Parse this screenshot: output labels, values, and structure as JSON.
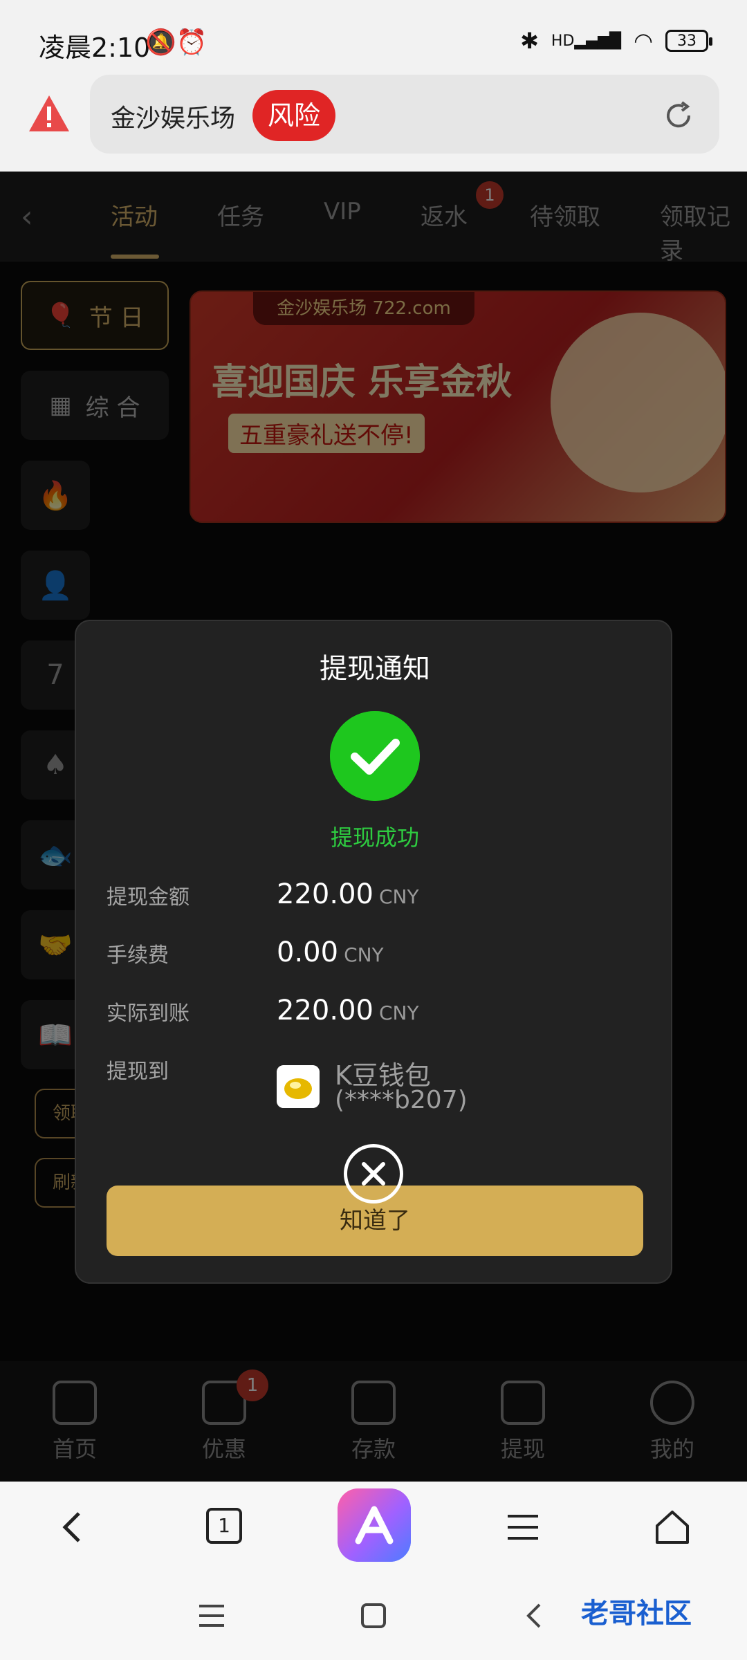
{
  "status_bar": {
    "time": "凌晨2:10",
    "battery": "33",
    "network": "HD"
  },
  "url_bar": {
    "site_name": "金沙娱乐场",
    "risk_label": "风险"
  },
  "tabs": {
    "items": [
      {
        "label": "活动",
        "active": true
      },
      {
        "label": "任务"
      },
      {
        "label": "VIP"
      },
      {
        "label": "返水",
        "badge": "1"
      },
      {
        "label": "待领取"
      },
      {
        "label": "领取记录"
      }
    ]
  },
  "sidebar": {
    "holiday": "节 日",
    "general": "综 合",
    "record_button": "领取记录",
    "refresh_button": "刷新奖励"
  },
  "banner": {
    "brand": "金沙娱乐场 722.com",
    "headline": "喜迎国庆 乐享金秋",
    "subline": "五重豪礼送不停!"
  },
  "modal": {
    "title": "提现通知",
    "status": "提现成功",
    "rows": [
      {
        "label": "提现金额",
        "value": "220.00",
        "unit": "CNY"
      },
      {
        "label": "手续费",
        "value": "0.00",
        "unit": "CNY"
      },
      {
        "label": "实际到账",
        "value": "220.00",
        "unit": "CNY"
      }
    ],
    "destination_label": "提现到",
    "wallet_name": "K豆钱包",
    "wallet_account": "(****b207)",
    "confirm_button": "知道了"
  },
  "site_nav": {
    "items": [
      {
        "label": "首页"
      },
      {
        "label": "优惠",
        "badge": "1"
      },
      {
        "label": "存款"
      },
      {
        "label": "提现"
      },
      {
        "label": "我的"
      }
    ]
  },
  "browser_bar": {
    "tab_count": "1"
  },
  "watermark": {
    "text": "老哥社区"
  },
  "colors": {
    "accent_gold": "#d4ae55",
    "success_green": "#1ec71e",
    "risk_red": "#e02525"
  }
}
